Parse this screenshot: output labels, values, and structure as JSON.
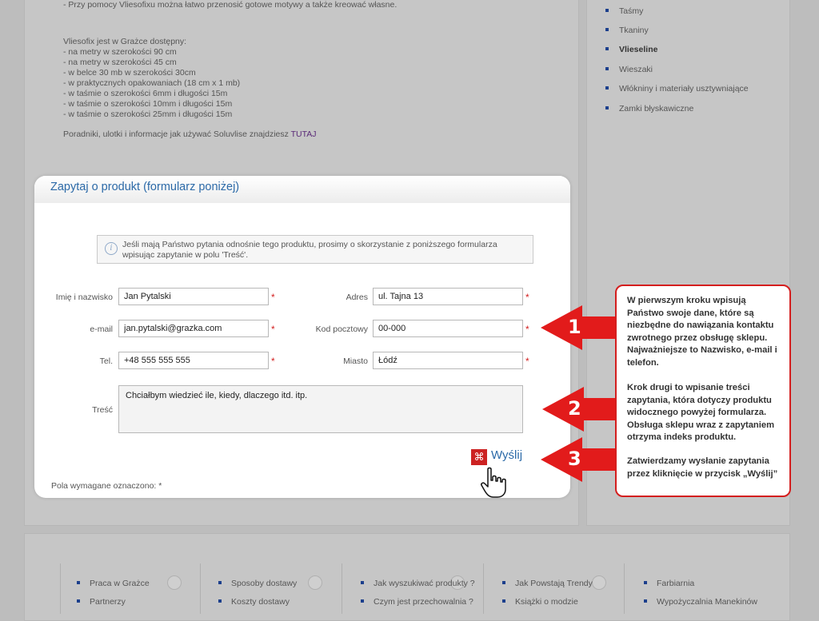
{
  "description": {
    "lines": [
      "- Przy pomocy Vliesofixu można łatwo przenosić gotowe motywy a także kreować własne.",
      "Vliesofix jest w Grażce dostępny:",
      "- na metry w szerokości 90 cm",
      "- na metry w szerokości 45 cm",
      "- w belce 30 mb w szerokości 30cm",
      "- w praktycznych opakowaniach (18 cm x 1 mb)",
      "- w taśmie o szerokości 6mm i długości 15m",
      "- w taśmie o szerokości 10mm i długości 15m",
      "- w taśmie o szerokości 25mm i długości 15m"
    ],
    "guide_text": "Poradniki, ulotki i informacje jak używać Soluvlise znajdziesz ",
    "guide_link": "TUTAJ"
  },
  "categories": [
    {
      "label": "Taśmy",
      "bold": false
    },
    {
      "label": "Tkaniny",
      "bold": false
    },
    {
      "label": "Vlieseline",
      "bold": true
    },
    {
      "label": "Wieszaki",
      "bold": false
    },
    {
      "label": "Włókniny i materiały usztywniające",
      "bold": false
    },
    {
      "label": "Zamki błyskawiczne",
      "bold": false
    }
  ],
  "form": {
    "title": "Zapytaj o produkt (formularz poniżej)",
    "info": "Jeśli mają Państwo pytania odnośnie tego produktu, prosimy o skorzystanie z poniższego formularza wpisując zapytanie w polu 'Treść'.",
    "fields": {
      "name": {
        "label": "Imię i nazwisko",
        "value": "Jan Pytalski"
      },
      "address": {
        "label": "Adres",
        "value": "ul. Tajna 13"
      },
      "email": {
        "label": "e-mail",
        "value": "jan.pytalski@grazka.com"
      },
      "postcode": {
        "label": "Kod pocztowy",
        "value": "00-000"
      },
      "phone": {
        "label": "Tel.",
        "value": "+48 555 555 555"
      },
      "city": {
        "label": "Miasto",
        "value": "Łódź"
      },
      "message": {
        "label": "Treść",
        "value": "Chciałbym wiedzieć ile, kiedy, dlaczego itd. itp."
      }
    },
    "required_mark": "*",
    "submit_label": "Wyślij",
    "submit_icon": "⌘",
    "required_note": "Pola wymagane oznaczono: *"
  },
  "annotation": {
    "steps": [
      "1",
      "2",
      "3"
    ],
    "paragraphs": [
      "W pierwszym kroku wpisują Państwo swoje dane, które są niezbędne do nawiązania kontaktu zwrotnego przez obsługę sklepu. Najważniejsze to Nazwisko, e-mail i telefon.",
      "Krok drugi to wpisanie treści zapytania, która dotyczy produktu widocznego powyżej formularza. Obsługa sklepu wraz z zapytaniem otrzyma indeks produktu.",
      "Zatwierdzamy wysłanie zapytania przez kliknięcie w przycisk „Wyślij”"
    ],
    "arrow_color": "#e21b1b"
  },
  "footer": {
    "columns": [
      [
        "Praca w Grażce",
        "Partnerzy"
      ],
      [
        "Sposoby dostawy",
        "Koszty dostawy"
      ],
      [
        "Jak wyszukiwać produkty ?",
        "Czym jest przechowalnia ?"
      ],
      [
        "Jak Powstają Trendy",
        "Książki o modzie"
      ],
      [
        "Farbiarnia",
        "Wypożyczalnia Manekinów"
      ]
    ]
  },
  "colors": {
    "overlay_bg": "#bdbdbd",
    "link_blue": "#2c6aa8",
    "required_red": "#d21e1e",
    "bullet_blue": "#1c3f8c"
  }
}
